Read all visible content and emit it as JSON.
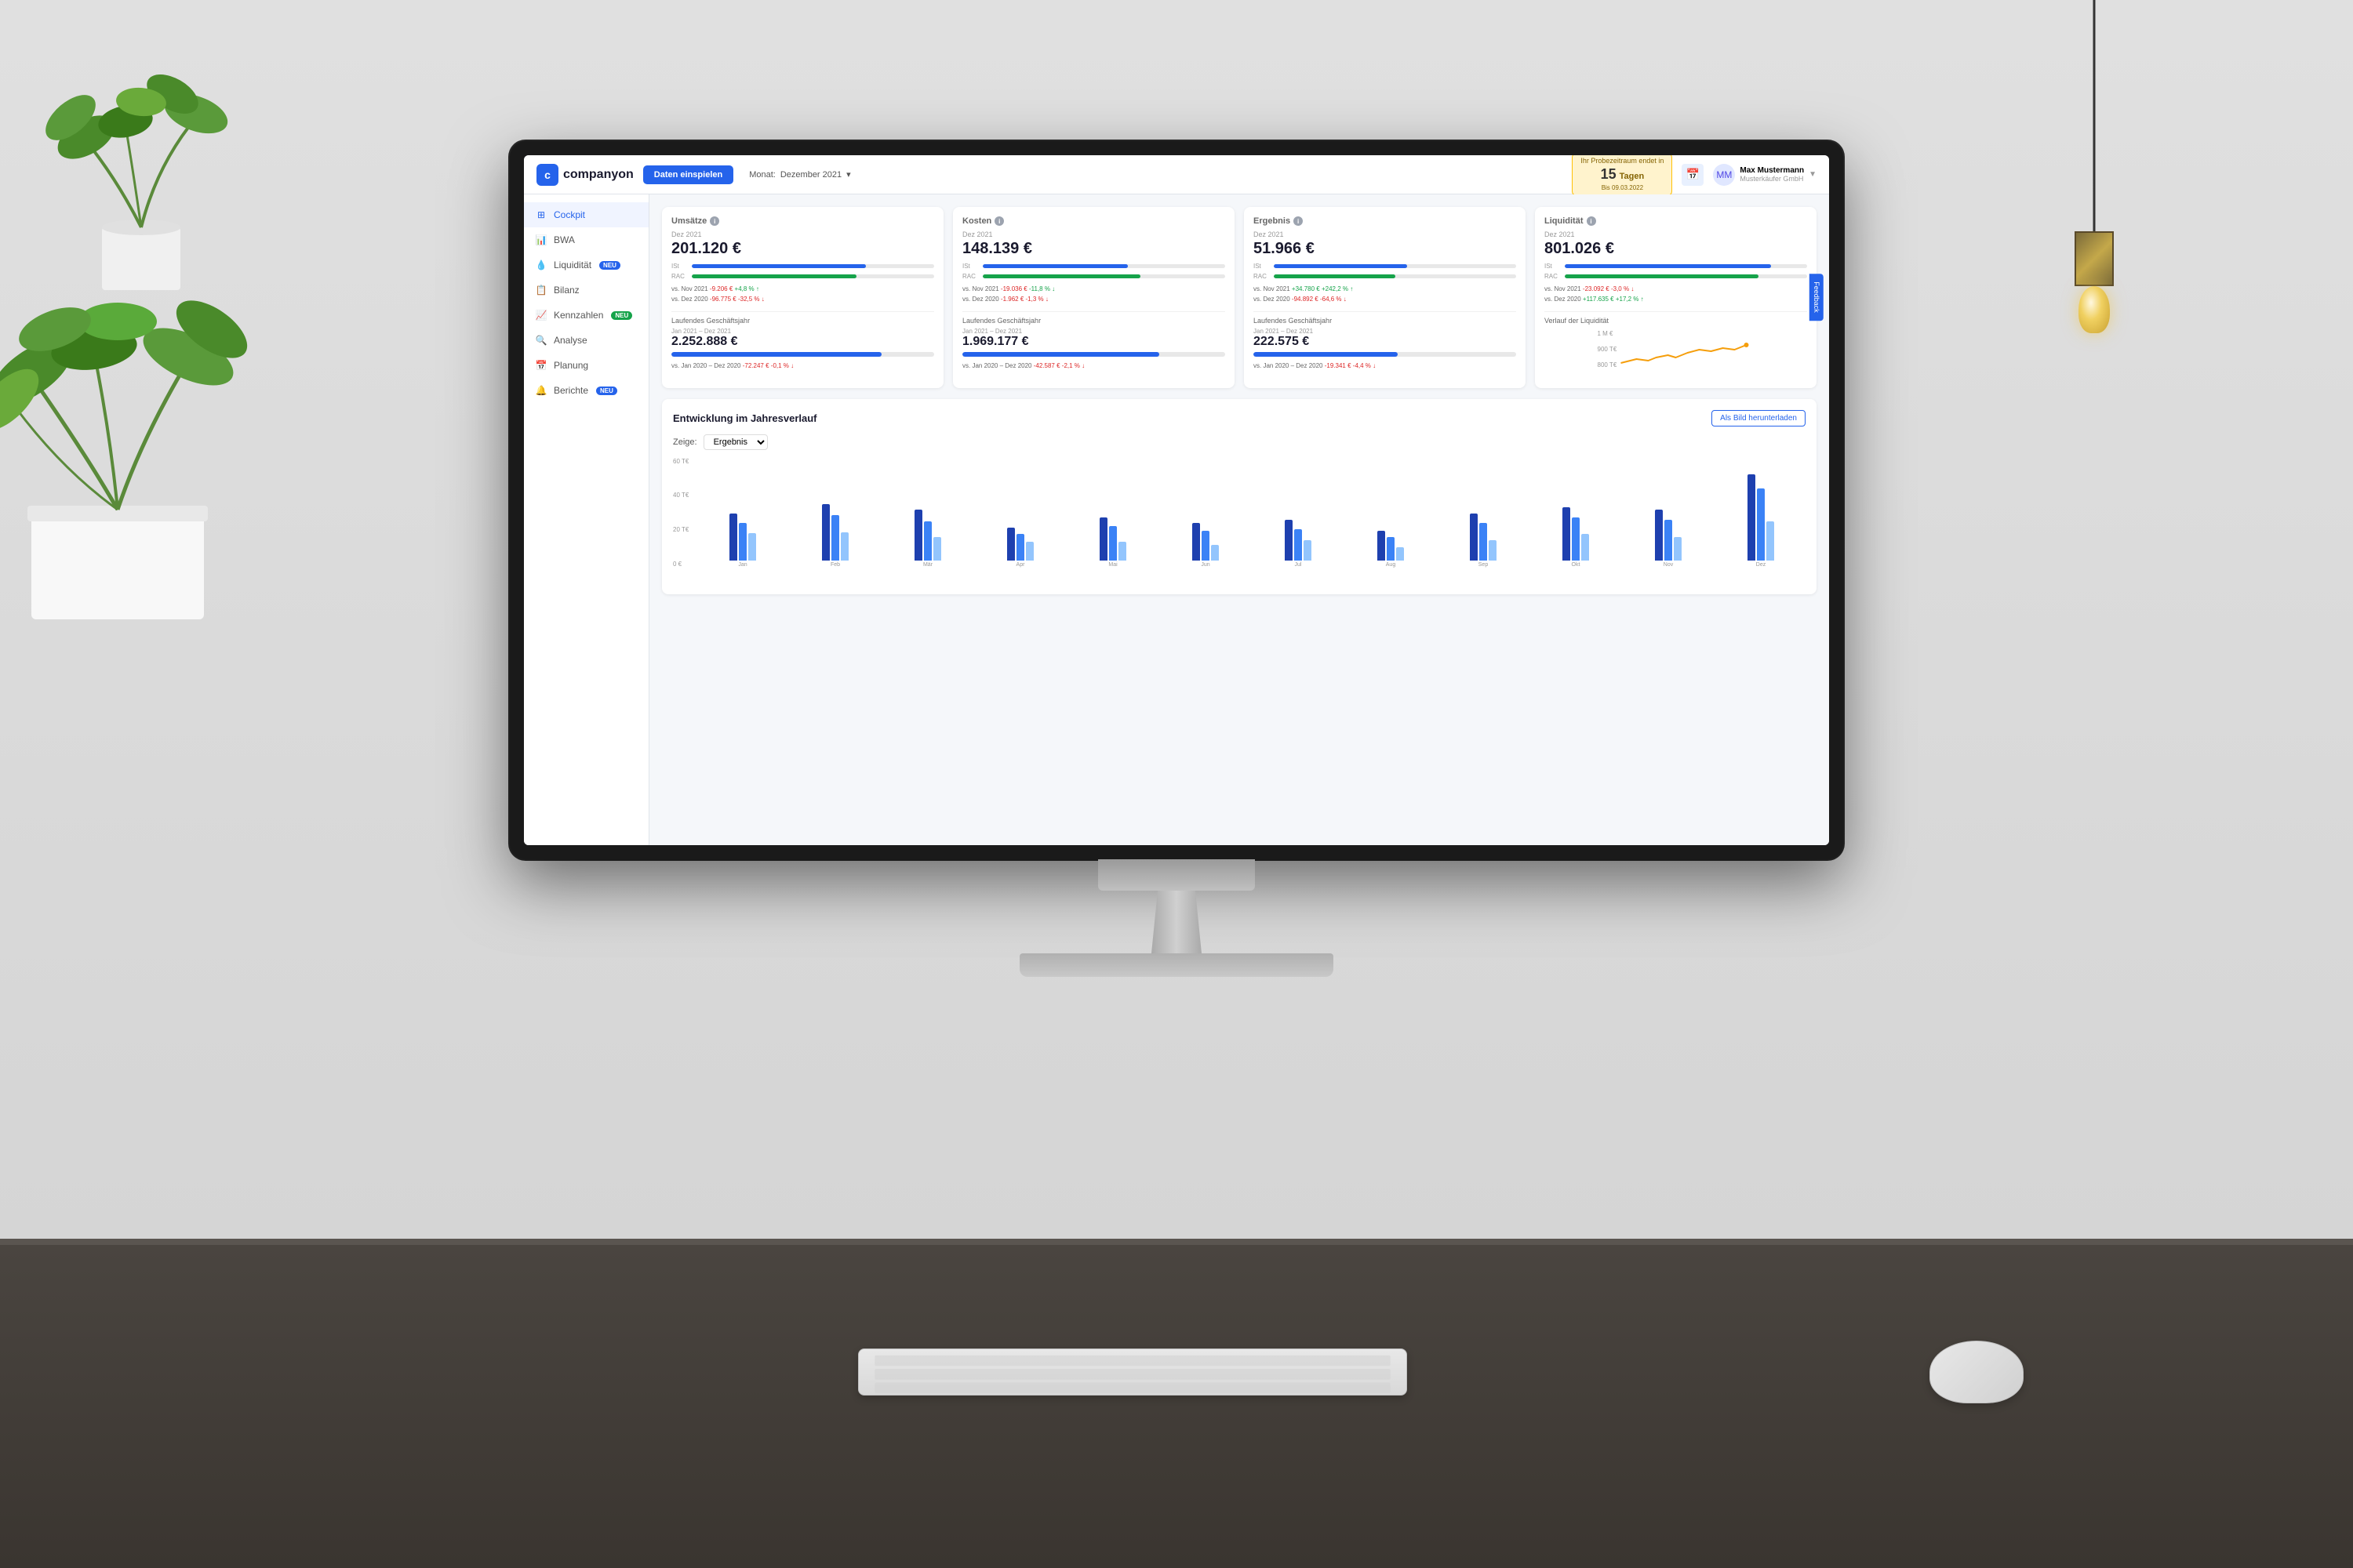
{
  "room": {
    "wall_color": "#e0e0e0",
    "desk_color": "#4a4540"
  },
  "header": {
    "logo_text": "companyon",
    "logo_icon": "c",
    "daten_button": "Daten einspielen",
    "monat_label": "Monat:",
    "monat_value": "Dezember 2021",
    "trial_label": "Ihr Probezeitraum endet in",
    "trial_days": "15",
    "trial_days_unit": "Tagen",
    "trial_date": "Bis 09.03.2022",
    "user_name": "Max Mustermann",
    "user_company": "Musterkäufer GmbH",
    "chevron": "▼"
  },
  "sidebar": {
    "items": [
      {
        "id": "cockpit",
        "label": "Cockpit",
        "icon": "⊞",
        "active": true,
        "badge": null
      },
      {
        "id": "bwa",
        "label": "BWA",
        "icon": "📊",
        "active": false,
        "badge": null
      },
      {
        "id": "liquiditaet",
        "label": "Liquidität",
        "icon": "💧",
        "active": false,
        "badge": "NEU",
        "badge_type": "blue"
      },
      {
        "id": "bilanz",
        "label": "Bilanz",
        "icon": "📋",
        "active": false,
        "badge": null
      },
      {
        "id": "kennzahlen",
        "label": "Kennzahlen",
        "icon": "📈",
        "active": false,
        "badge": "NEU",
        "badge_type": "green"
      },
      {
        "id": "analyse",
        "label": "Analyse",
        "icon": "🔍",
        "active": false,
        "badge": null
      },
      {
        "id": "planung",
        "label": "Planung",
        "icon": "📅",
        "active": false,
        "badge": null
      },
      {
        "id": "berichte",
        "label": "Berichte",
        "icon": "🔔",
        "active": false,
        "badge": "NEU",
        "badge_type": "blue"
      }
    ]
  },
  "kpi_cards": [
    {
      "id": "umsaetze",
      "title": "Umsätze",
      "period": "Dez 2021",
      "value": "201.120 €",
      "bar_ist_pct": 72,
      "bar_rac_pct": 68,
      "comparison_prev_month_label": "vs. Nov 2021",
      "comparison_prev_month_val": "-9.206 €",
      "comparison_prev_month_pct": "+4,8 %",
      "comparison_prev_month_direction": "up",
      "comparison_prev_year_label": "vs. Dez 2020",
      "comparison_prev_year_val": "-96.775 €",
      "comparison_prev_year_pct": "-32,5 %",
      "comparison_prev_year_direction": "down",
      "sub_title": "Laufendes Geschäftsjahr",
      "sub_period": "Jan 2021 – Dez 2021",
      "sub_value": "2.252.888 €",
      "sub_bar_pct": 80,
      "sub_comparison_label": "vs. Jan 2020 – Dez 2020",
      "sub_comparison_val": "-72.247 €",
      "sub_comparison_pct": "-0,1 %",
      "sub_comparison_direction": "down"
    },
    {
      "id": "kosten",
      "title": "Kosten",
      "period": "Dez 2021",
      "value": "148.139 €",
      "bar_ist_pct": 60,
      "bar_rac_pct": 65,
      "comparison_prev_month_label": "vs. Nov 2021",
      "comparison_prev_month_val": "-19.036 €",
      "comparison_prev_month_pct": "-11,8 %",
      "comparison_prev_month_direction": "down",
      "comparison_prev_year_label": "vs. Dez 2020",
      "comparison_prev_year_val": "-1.962 €",
      "comparison_prev_year_pct": "-1,3 %",
      "comparison_prev_year_direction": "down",
      "sub_title": "Laufendes Geschäftsjahr",
      "sub_period": "Jan 2021 – Dez 2021",
      "sub_value": "1.969.177 €",
      "sub_bar_pct": 75,
      "sub_comparison_label": "vs. Jan 2020 – Dez 2020",
      "sub_comparison_val": "-42.587 €",
      "sub_comparison_pct": "-2,1 %",
      "sub_comparison_direction": "down"
    },
    {
      "id": "ergebnis",
      "title": "Ergebnis",
      "period": "Dez 2021",
      "value": "51.966 €",
      "bar_ist_pct": 55,
      "bar_rac_pct": 50,
      "comparison_prev_month_label": "vs. Nov 2021",
      "comparison_prev_month_val": "+34.780 €",
      "comparison_prev_month_pct": "+242,2 %",
      "comparison_prev_month_direction": "up",
      "comparison_prev_year_label": "vs. Dez 2020",
      "comparison_prev_year_val": "-94.892 €",
      "comparison_prev_year_pct": "-64,6 %",
      "comparison_prev_year_direction": "down",
      "sub_title": "Laufendes Geschäftsjahr",
      "sub_period": "Jan 2021 – Dez 2021",
      "sub_value": "222.575 €",
      "sub_bar_pct": 55,
      "sub_comparison_label": "vs. Jan 2020 – Dez 2020",
      "sub_comparison_val": "-19.341 €",
      "sub_comparison_pct": "-4,4 %",
      "sub_comparison_direction": "down"
    },
    {
      "id": "liquiditaet",
      "title": "Liquidität",
      "period": "Dez 2021",
      "value": "801.026 €",
      "bar_ist_pct": 85,
      "bar_rac_pct": 80,
      "comparison_prev_month_label": "vs. Nov 2021",
      "comparison_prev_month_val": "-23.092 €",
      "comparison_prev_month_pct": "-3,0 %",
      "comparison_prev_month_direction": "down",
      "comparison_prev_year_label": "vs. Dez 2020",
      "comparison_prev_year_val": "+117.635 €",
      "comparison_prev_year_pct": "+17,2 %",
      "comparison_prev_year_direction": "up",
      "sub_title": "Verlauf der Liquidität",
      "sub_period": null,
      "sub_value": null,
      "sub_bar_pct": null
    }
  ],
  "chart_section": {
    "title": "Entwicklung im Jahresverlauf",
    "download_btn": "Als Bild herunterladen",
    "filter_label": "Zeige:",
    "filter_value": "Ergebnis",
    "y_labels": [
      "60 T€",
      "40 T€",
      "20 T€",
      "0 €"
    ],
    "months": [
      {
        "label": "Jan",
        "dark": 35,
        "mid": 28,
        "light": 20
      },
      {
        "label": "Feb",
        "dark": 42,
        "mid": 35,
        "light": 22
      },
      {
        "label": "Mär",
        "dark": 38,
        "mid": 30,
        "light": 18
      },
      {
        "label": "Apr",
        "dark": 25,
        "mid": 20,
        "light": 15
      },
      {
        "label": "Mai",
        "dark": 32,
        "mid": 26,
        "light": 14
      },
      {
        "label": "Jun",
        "dark": 28,
        "mid": 22,
        "light": 12
      },
      {
        "label": "Jul",
        "dark": 30,
        "mid": 24,
        "light": 16
      },
      {
        "label": "Aug",
        "dark": 22,
        "mid": 18,
        "light": 10
      },
      {
        "label": "Sep",
        "dark": 35,
        "mid": 28,
        "light": 15
      },
      {
        "label": "Okt",
        "dark": 40,
        "mid": 32,
        "light": 20
      },
      {
        "label": "Nov",
        "dark": 38,
        "mid": 30,
        "light": 18
      },
      {
        "label": "Dez",
        "dark": 65,
        "mid": 55,
        "light": 30
      }
    ]
  },
  "feedback": {
    "label": "Feedback"
  }
}
